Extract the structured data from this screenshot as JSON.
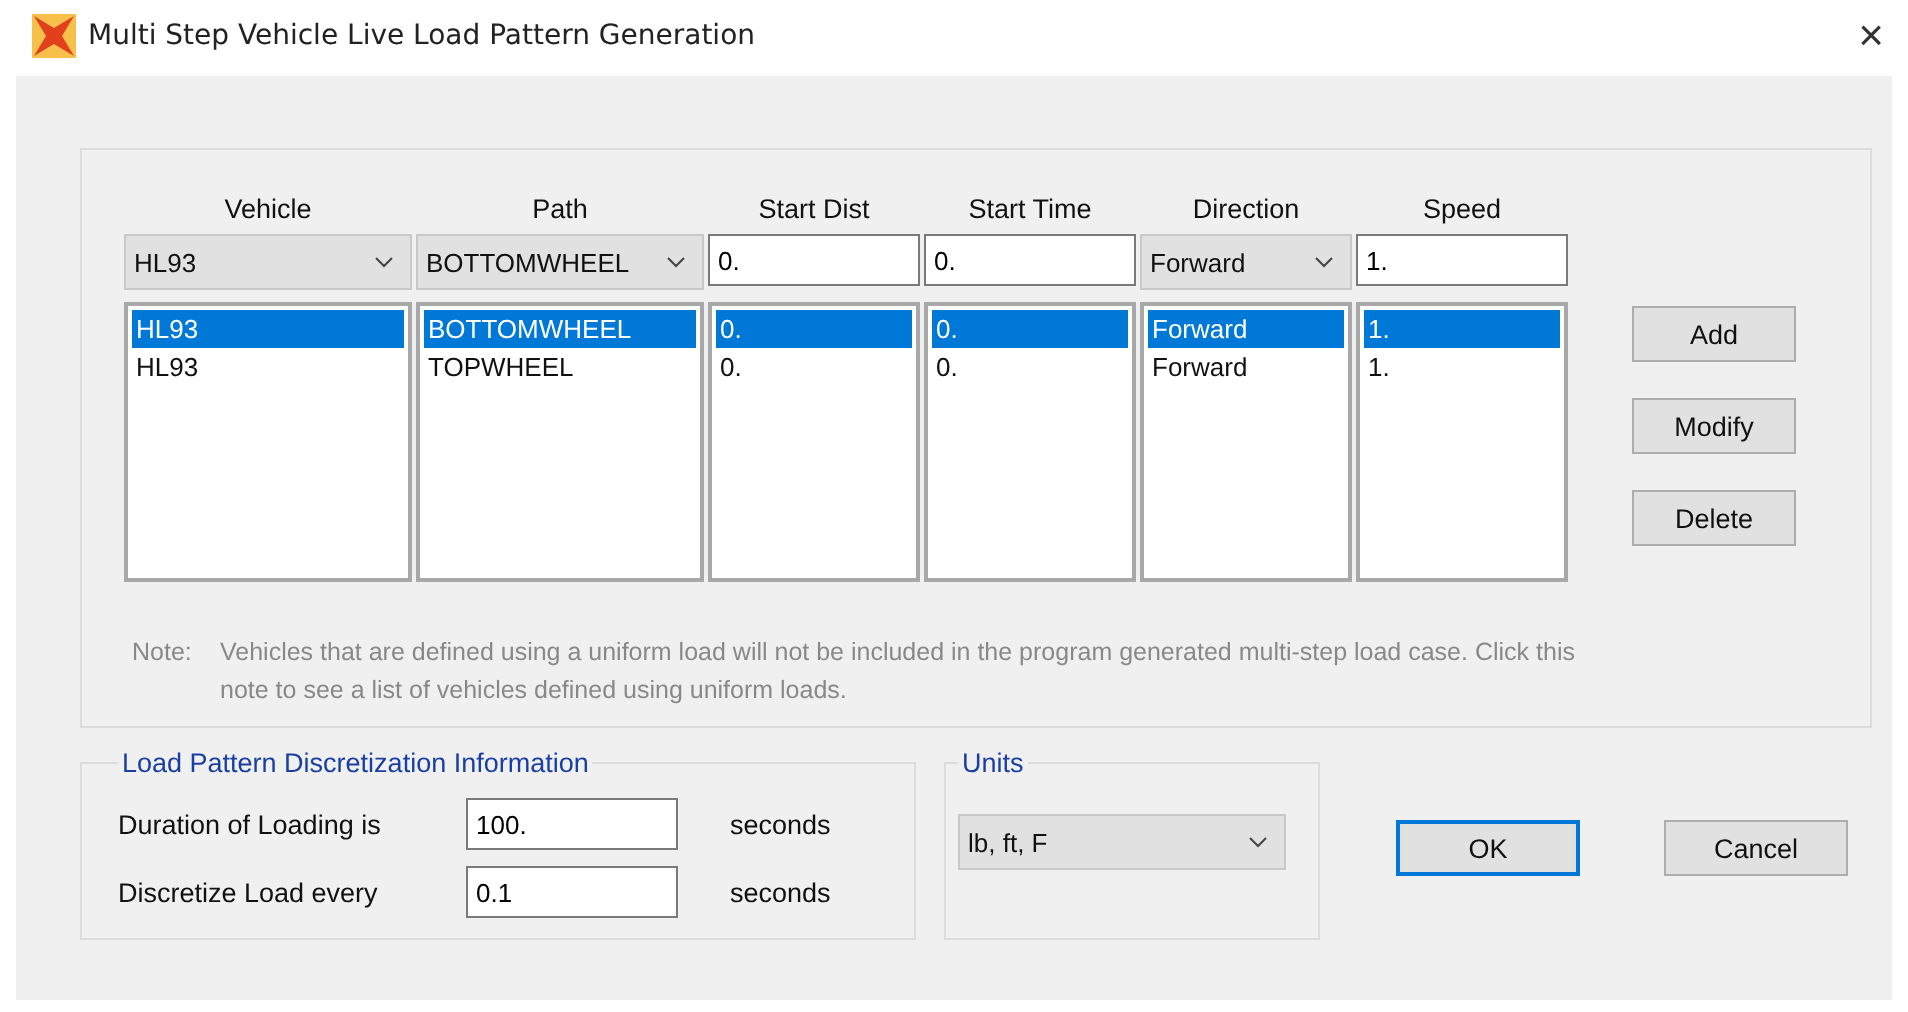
{
  "window": {
    "title": "Multi Step Vehicle Live Load Pattern Generation",
    "close": "×"
  },
  "columns": [
    {
      "header": "Vehicle",
      "input": {
        "kind": "combo",
        "value": "HL93"
      }
    },
    {
      "header": "Path",
      "input": {
        "kind": "combo",
        "value": "BOTTOMWHEEL"
      }
    },
    {
      "header": "Start Dist",
      "input": {
        "kind": "text",
        "value": "0."
      }
    },
    {
      "header": "Start Time",
      "input": {
        "kind": "text",
        "value": "0."
      }
    },
    {
      "header": "Direction",
      "input": {
        "kind": "combo",
        "value": "Forward"
      }
    },
    {
      "header": "Speed",
      "input": {
        "kind": "text",
        "value": "1."
      }
    }
  ],
  "rows": [
    {
      "selected": true,
      "cells": [
        "HL93",
        "BOTTOMWHEEL",
        "0.",
        "0.",
        "Forward",
        "1."
      ]
    },
    {
      "selected": false,
      "cells": [
        "HL93",
        "TOPWHEEL",
        "0.",
        "0.",
        "Forward",
        "1."
      ]
    }
  ],
  "side_buttons": [
    "Add",
    "Modify",
    "Delete"
  ],
  "note": {
    "label": "Note:",
    "text": "Vehicles that are defined using a uniform load will not be included in the program generated multi-step load case.  Click this note to see a list of vehicles defined using uniform loads."
  },
  "discretization": {
    "title": "Load Pattern Discretization Information",
    "fields": [
      {
        "label": "Duration of Loading is",
        "value": "100.",
        "unit": "seconds"
      },
      {
        "label": "Discretize Load every",
        "value": "0.1",
        "unit": "seconds"
      }
    ]
  },
  "units": {
    "title": "Units",
    "value": "lb, ft, F"
  },
  "buttons": [
    {
      "label": "OK",
      "focused": true
    },
    {
      "label": "Cancel",
      "focused": false
    }
  ]
}
